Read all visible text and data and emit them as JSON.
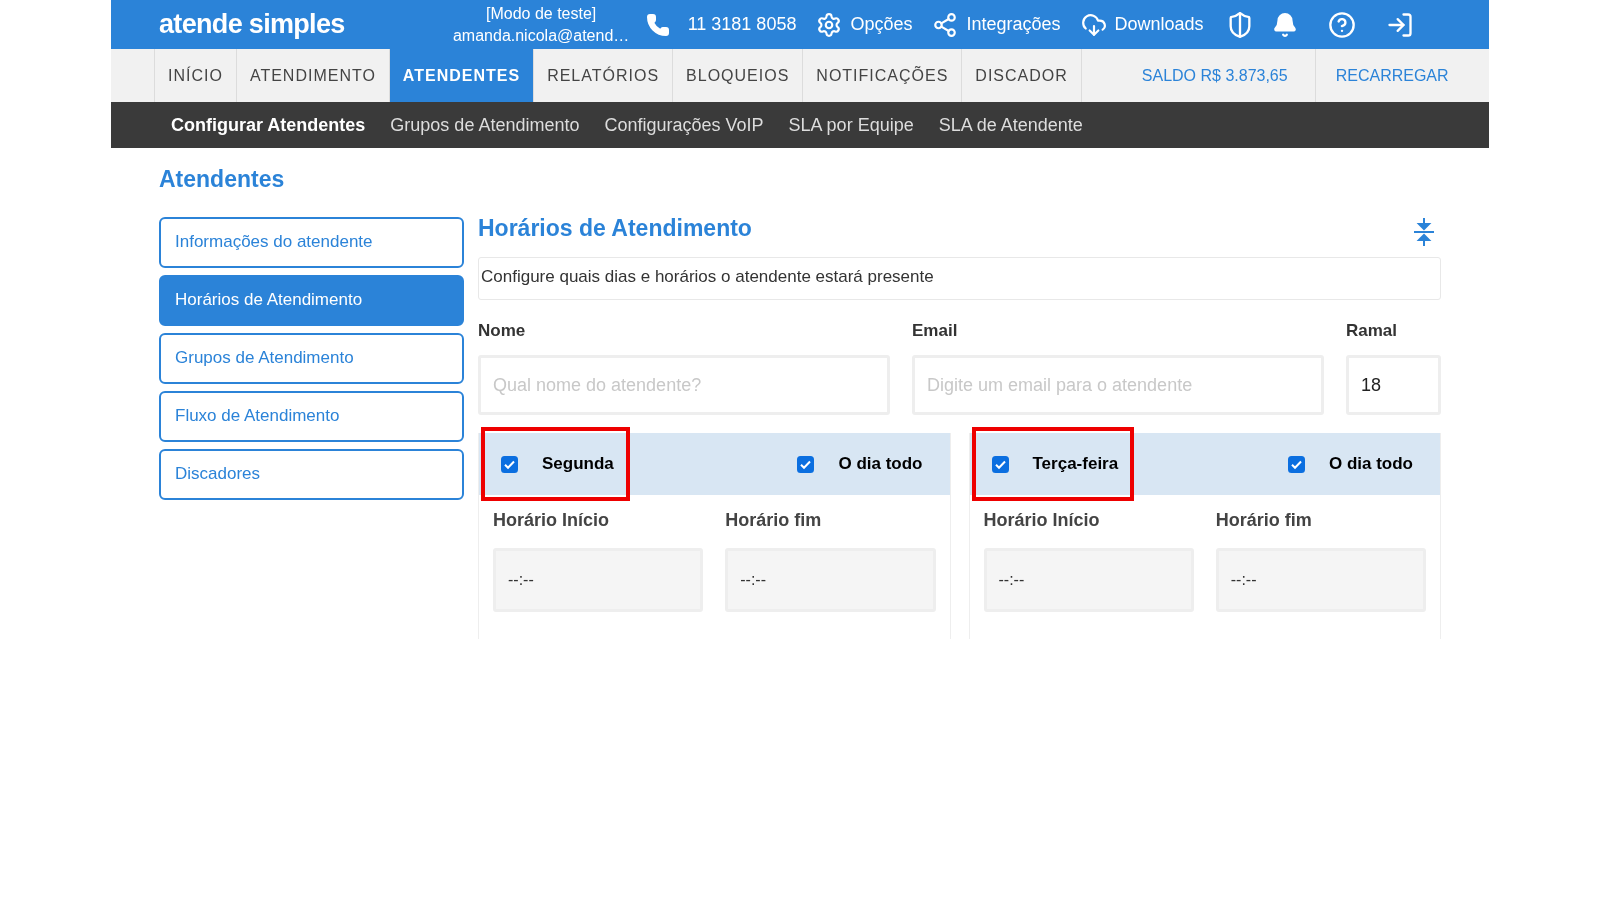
{
  "header": {
    "logo": "atende simples",
    "mode": "[Modo de teste]",
    "user": "amanda.nicola@atend…",
    "phone": "11 3181 8058",
    "links": [
      "Opções",
      "Integrações",
      "Downloads"
    ]
  },
  "nav": {
    "tabs": [
      {
        "label": "INÍCIO",
        "selected": false
      },
      {
        "label": "ATENDIMENTO",
        "selected": false
      },
      {
        "label": "ATENDENTES",
        "selected": true
      },
      {
        "label": "RELATÓRIOS",
        "selected": false
      },
      {
        "label": "BLOQUEIOS",
        "selected": false
      },
      {
        "label": "NOTIFICAÇÕES",
        "selected": false
      },
      {
        "label": "DISCADOR",
        "selected": false
      }
    ],
    "balance": "SALDO R$ 3.873,65",
    "recharge": "RECARREGAR"
  },
  "subnav": [
    {
      "label": "Configurar Atendentes",
      "selected": true
    },
    {
      "label": "Grupos de Atendimento",
      "selected": false
    },
    {
      "label": "Configurações VoIP",
      "selected": false
    },
    {
      "label": "SLA por Equipe",
      "selected": false
    },
    {
      "label": "SLA de Atendente",
      "selected": false
    }
  ],
  "page_title": "Atendentes",
  "sidebar": [
    {
      "label": "Informações do atendente",
      "selected": false
    },
    {
      "label": "Horários de Atendimento",
      "selected": true
    },
    {
      "label": "Grupos de Atendimento",
      "selected": false
    },
    {
      "label": "Fluxo de Atendimento",
      "selected": false
    },
    {
      "label": "Discadores",
      "selected": false
    }
  ],
  "section": {
    "title": "Horários de Atendimento",
    "description": "Configure quais dias e horários o atendente estará presente"
  },
  "fields": [
    {
      "label": "Nome",
      "placeholder": "Qual nome do atendente?"
    },
    {
      "label": "Email",
      "placeholder": "Digite um email para o atendente"
    },
    {
      "label": "Ramal",
      "value": "18"
    }
  ],
  "days": [
    {
      "name": "Segunda",
      "checked": true,
      "highlighted": true,
      "all_day_label": "O dia todo",
      "all_day": true,
      "start_label": "Horário Início",
      "start": "--:--",
      "end_label": "Horário fim",
      "end": "--:--"
    },
    {
      "name": "Terça-feira",
      "checked": true,
      "highlighted": true,
      "all_day_label": "O dia todo",
      "all_day": true,
      "start_label": "Horário Início",
      "start": "--:--",
      "end_label": "Horário fim",
      "end": "--:--"
    }
  ]
}
